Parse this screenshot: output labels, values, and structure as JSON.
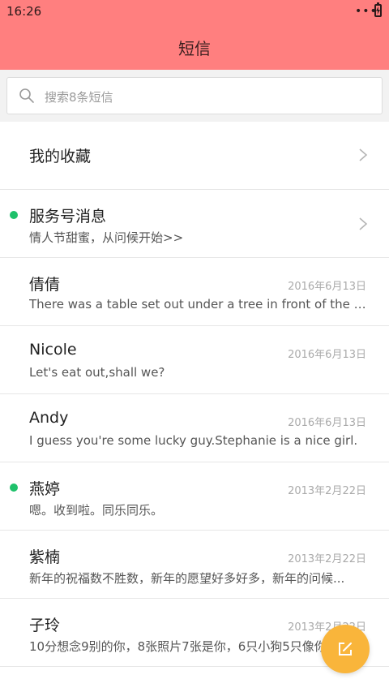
{
  "status_bar": {
    "time": "16:26",
    "dots": "•••"
  },
  "header": {
    "title": "短信"
  },
  "search": {
    "placeholder": "搜索8条短信"
  },
  "favorites": {
    "label": "我的收藏"
  },
  "service": {
    "title": "服务号消息",
    "preview": "情人节甜蜜，从问候开始>>"
  },
  "messages": [
    {
      "name": "倩倩",
      "date": "2016年6月13日",
      "preview": "There was a table set out under a tree in front of the ho..."
    },
    {
      "name": "Nicole",
      "date": "2016年6月13日",
      "preview": "Let's eat out,shall we?"
    },
    {
      "name": "Andy",
      "date": "2016年6月13日",
      "preview": "I guess you're some lucky guy.Stephanie is a nice girl."
    },
    {
      "name": "燕婷",
      "date": "2013年2月22日",
      "preview": "嗯。收到啦。同乐同乐。",
      "unread": true
    },
    {
      "name": "紫楠",
      "date": "2013年2月22日",
      "preview": "新年的祝福数不胜数，新年的愿望好多好多，新年的问候..."
    },
    {
      "name": "子玲",
      "date": "2013年2月22日",
      "preview": "10分想念9别的你，8张照片7张是你，6只小狗5只像你"
    }
  ],
  "colors": {
    "header_bg": "#ff7f7f",
    "unread_dot": "#1fc16b",
    "fab": "#f9b53b"
  },
  "icons": {
    "search": "search-icon",
    "chevron": "chevron-right-icon",
    "compose": "compose-icon"
  }
}
